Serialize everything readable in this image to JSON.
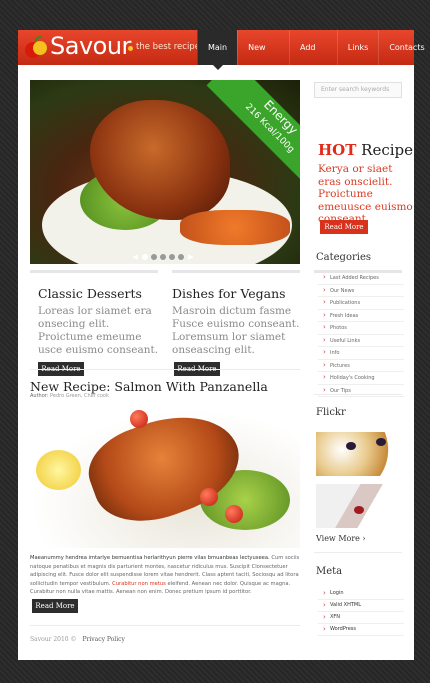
{
  "header": {
    "logo": "Savour",
    "tagline": "the best recipes",
    "nav": [
      "Main",
      "New Recipes",
      "Add Recipe",
      "Links",
      "Contacts"
    ]
  },
  "hero": {
    "ribbon_line1": "Energy",
    "ribbon_line2": "216 Kcal/100g"
  },
  "search": {
    "placeholder": "Enter search keywords"
  },
  "hot": {
    "title_hot": "HOT",
    "title_rest": " Recipe",
    "text": "Kerya or siaet eras onscielit. Proictume emeuusce euismo conseant.",
    "button": "Read More"
  },
  "columns": [
    {
      "title": "Classic Desserts",
      "text": "Loreas lor siamet era onsecing elit. Proictume emeume usce euismo conseant.",
      "button": "Read More"
    },
    {
      "title": "Dishes for Vegans",
      "text": "Masroin dictum fasme Fusce euismo conseant. Loremsum lor siamet onseascing elit.",
      "button": "Read More"
    }
  ],
  "article": {
    "title": "New Recipe: Salmon With Panzanella",
    "author_label": "Author:",
    "author": "Pedro Green, Chef cook",
    "lead": "Maeanummy hendrea imtarlye bemuentisa herlarithyun pierre vilas bmuanbeas lectyuseea.",
    "body_a": "Cum sociis natoque penatibus et magnis dis parturient montes, nascetur ridiculus mus. Suscipit Clonsectetuer adipiscing elit. Fusce dolor elit suspendisse lorem vitae hendrerit. Class aptent taciti, Sociosqu ad litora sollicitudin tempor vestibulum.",
    "body_red": "Curabitur non metus",
    "body_b": "eleifend. Aenean nec dolor. Quisque ac magna. Curabitur non nulla vitae mattis. Aenean non enim. Donec pretium ipsum id porttitor.",
    "button": "Read More"
  },
  "footer": {
    "copyright": "Savour 2010 ©",
    "privacy": "Privacy Policy"
  },
  "sidebar": {
    "categories_title": "Categories",
    "categories": [
      "Last Added Recipes",
      "Our News",
      "Publications",
      "Fresh Ideas",
      "Photos",
      "Useful Links",
      "Info",
      "Pictures",
      "Holiday's Cooking",
      "Our Tips"
    ],
    "flickr_title": "Flickr",
    "view_more": "View More",
    "meta_title": "Meta",
    "meta": [
      "Login",
      "Valid XHTML",
      "XFN",
      "WordPress"
    ]
  },
  "colors": {
    "accent": "#d8311c",
    "dark": "#2d2d2d",
    "ribbon": "#3aa52a"
  }
}
